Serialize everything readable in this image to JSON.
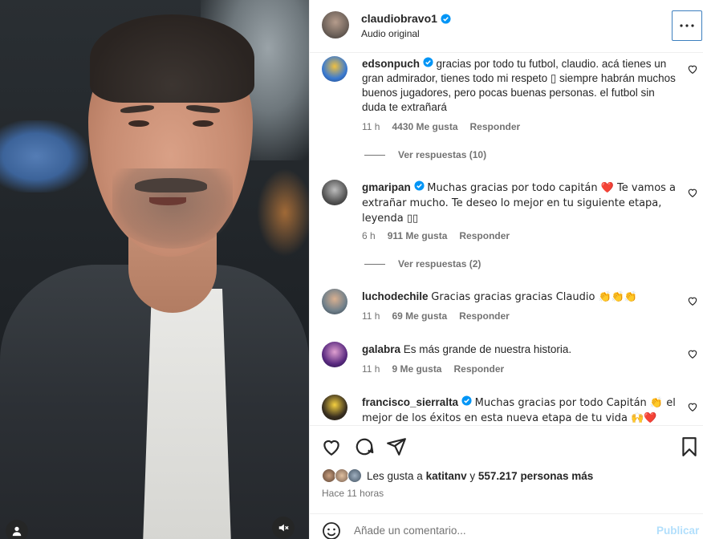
{
  "header": {
    "username": "claudiobravo1",
    "subtitle": "Audio original",
    "more_icon": "more-horizontal-icon"
  },
  "comments": [
    {
      "username": "edsonpuch",
      "verified": true,
      "text": "gracias por todo tu futbol, claudio. acá tienes un gran admirador, tienes todo mi respeto ▯ siempre habrán muchos buenos jugadores, pero pocas buenas personas. el futbol sin duda te extrañará",
      "time": "11 h",
      "likes": "4430 Me gusta",
      "reply": "Responder",
      "view_replies": "Ver respuestas (10)"
    },
    {
      "username": "gmaripan",
      "verified": true,
      "text": "Muchas gracias por todo capitán ❤️ Te vamos a extrañar mucho. Te deseo lo mejor en tu siguiente etapa, leyenda ▯▯",
      "time": "6 h",
      "likes": "911 Me gusta",
      "reply": "Responder",
      "view_replies": "Ver respuestas (2)"
    },
    {
      "username": "luchodechile",
      "verified": false,
      "text": "Gracias gracias gracias Claudio 👏👏👏",
      "time": "11 h",
      "likes": "69 Me gusta",
      "reply": "Responder"
    },
    {
      "username": "galabra",
      "verified": false,
      "text": "Es más grande de nuestra historia.",
      "time": "11 h",
      "likes": "9 Me gusta",
      "reply": "Responder"
    },
    {
      "username": "francisco_sierralta",
      "verified": true,
      "text": "Muchas gracias por todo Capitán 👏 el mejor de los éxitos en esta nueva etapa de tu vida 🙌❤️"
    }
  ],
  "likes": {
    "prefix": "Les gusta a",
    "user": "katitanv",
    "connector": "y",
    "count": "557.217 personas más"
  },
  "time_ago": "Hace 11 horas",
  "add_comment": {
    "placeholder": "Añade un comentario...",
    "post_label": "Publicar"
  },
  "colors": {
    "accent": "#0095f6",
    "post_disabled": "#b2dffc",
    "heart": "#ed1c24",
    "muted": "#737373"
  }
}
